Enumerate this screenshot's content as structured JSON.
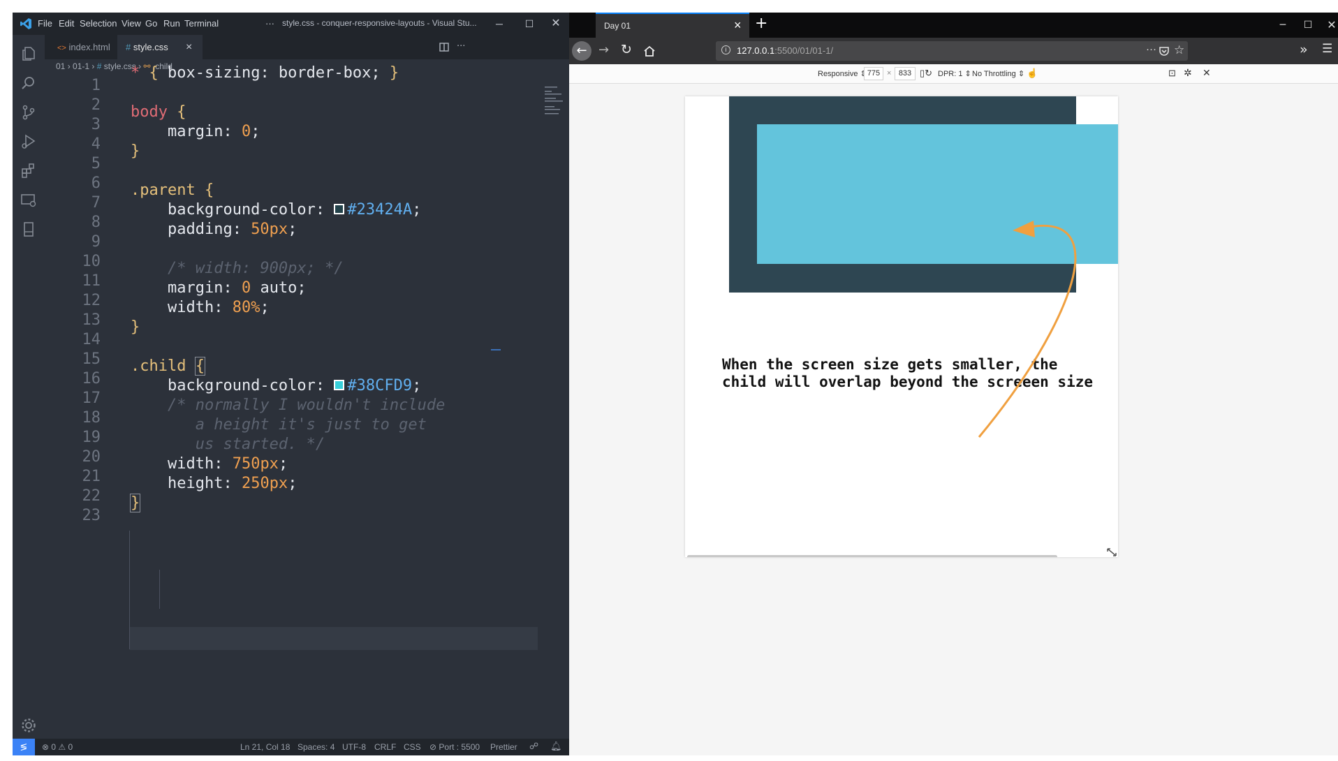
{
  "vscode": {
    "menu": [
      "File",
      "Edit",
      "Selection",
      "View",
      "Go",
      "Run",
      "Terminal"
    ],
    "overflow": "···",
    "window_title": "style.css - conquer-responsive-layouts - Visual Stu...",
    "tabs": [
      {
        "icon": "html-icon",
        "label": "index.html"
      },
      {
        "icon": "css-hash-icon",
        "label": "style.css"
      }
    ],
    "tab_close": "×",
    "breadcrumb": {
      "folder1": "01",
      "folder2": "01-1",
      "file": "style.css",
      "symbol": ".child"
    },
    "editor": {
      "lines": [
        "1",
        "2",
        "3",
        "4",
        "5",
        "6",
        "7",
        "8",
        "9",
        "10",
        "11",
        "12",
        "13",
        "14",
        "15",
        "16",
        "17",
        "18",
        "19",
        "20",
        "21",
        "22",
        "23"
      ],
      "l1": {
        "sel": "* ",
        "open": "{",
        "prop": " box-sizing: border-box; ",
        "close": "}"
      },
      "l3": {
        "sel": "body ",
        "open": "{"
      },
      "l4": {
        "prop": "    margin: ",
        "val": "0",
        "end": ";"
      },
      "l5": {
        "close": "}"
      },
      "l7": {
        "sel": ".parent ",
        "open": "{"
      },
      "l8": {
        "prop": "    background-color: ",
        "val": "#23424A",
        "end": ";"
      },
      "l9": {
        "prop": "    padding: ",
        "val": "50px",
        "end": ";"
      },
      "l11": {
        "cmt": "    /* width: 900px; */"
      },
      "l12": {
        "prop": "    margin: ",
        "val": "0",
        "rest": " auto;"
      },
      "l13": {
        "prop": "    width: ",
        "val": "80%",
        "end": ";"
      },
      "l14": {
        "close": "}"
      },
      "l16": {
        "sel": ".child ",
        "open": "{"
      },
      "l17": {
        "prop": "    background-color: ",
        "val": "#38CFD9",
        "end": ";"
      },
      "l18": {
        "cmt": "    /* normally I wouldn't include"
      },
      "l19": {
        "cmt": "       a height it's just to get"
      },
      "l20": {
        "cmt": "       us started. */"
      },
      "l21": {
        "prop": "    width: ",
        "val": "750px",
        "end": ";"
      },
      "l22": {
        "prop": "    height: ",
        "val": "250px",
        "end": ";"
      },
      "l23": {
        "close": "}"
      }
    },
    "swatches": {
      "parent": "#23424A",
      "child": "#38CFD9"
    },
    "status": {
      "problems": "⊗ 0 ⚠ 0",
      "position": "Ln 21, Col 18",
      "spaces": "Spaces: 4",
      "encoding": "UTF-8",
      "eol": "CRLF",
      "language": "CSS",
      "port": "⊘ Port : 5500",
      "formatter": "Prettier"
    }
  },
  "firefox": {
    "tab_title": "Day 01",
    "tab_close": "×",
    "new_tab": "+",
    "url_host": "127.0.0.1",
    "url_path": ":5500/01/01-1/",
    "rdm": {
      "device": "Responsive",
      "width": "775",
      "times": "×",
      "height": "833",
      "dpr": "DPR: 1",
      "throttling": "No Throttling"
    },
    "viewport": {
      "parent_color": "#2e4652",
      "child_color": "#63c4dc",
      "annotation_line1": "When the screen size gets smaller, the",
      "annotation_line2": "child will overlap beyond the screeen size"
    }
  },
  "colors": {
    "arrow": "#f0a040",
    "accent": "#0a84ff"
  }
}
